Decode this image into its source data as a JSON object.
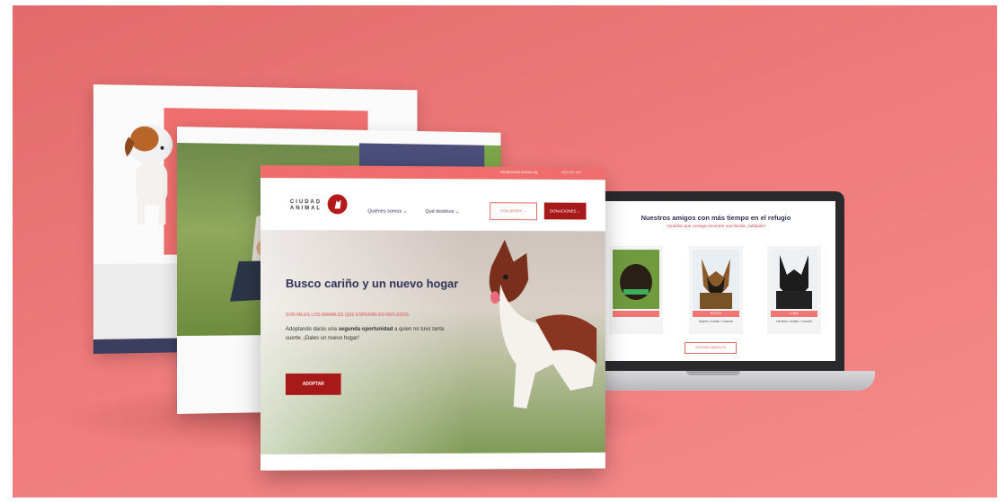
{
  "front_page": {
    "topbar": {
      "email": "info@ciudad-animal.org",
      "phone": "913 213 124"
    },
    "logo": {
      "line1": "CIUDAD",
      "line2": "ANIMAL"
    },
    "nav": [
      {
        "label": "Quiénes somos"
      },
      {
        "label": "Qué destinos"
      }
    ],
    "buttons": {
      "outline": "COLABORA",
      "solid": "DONACIONES"
    },
    "hero": {
      "title": "Busco cariño y un nuevo hogar",
      "kicker": "SON MILES LOS ANIMALES QUE ESPERAN EN REFUGIOS",
      "body_prefix": "Adoptando darás una ",
      "body_bold": "segunda oportunidad",
      "body_suffix": " a quien no tuvo tanta suerte. ¡Dales un nuevo hogar!",
      "cta": "ADOPTAR"
    }
  },
  "laptop": {
    "title": "Nuestros amigos con más tiempo en el refugio",
    "subtitle": "Ayúdalos que consiga encontrar una familia, ¡adóptalo!",
    "cards": [
      {
        "name": "",
        "meta": ""
      },
      {
        "name": "ROCKY",
        "meta": "Macho / Adulto / Grande"
      },
      {
        "name": "LUNA",
        "meta": "Hembra / Adulto / Grande"
      }
    ],
    "more_button": "VER MÁS ANIMALES"
  },
  "colors": {
    "background": "#ef7676",
    "brand_red": "#a81a1a",
    "coral": "#ef6d6d",
    "navy": "#2f3155"
  }
}
